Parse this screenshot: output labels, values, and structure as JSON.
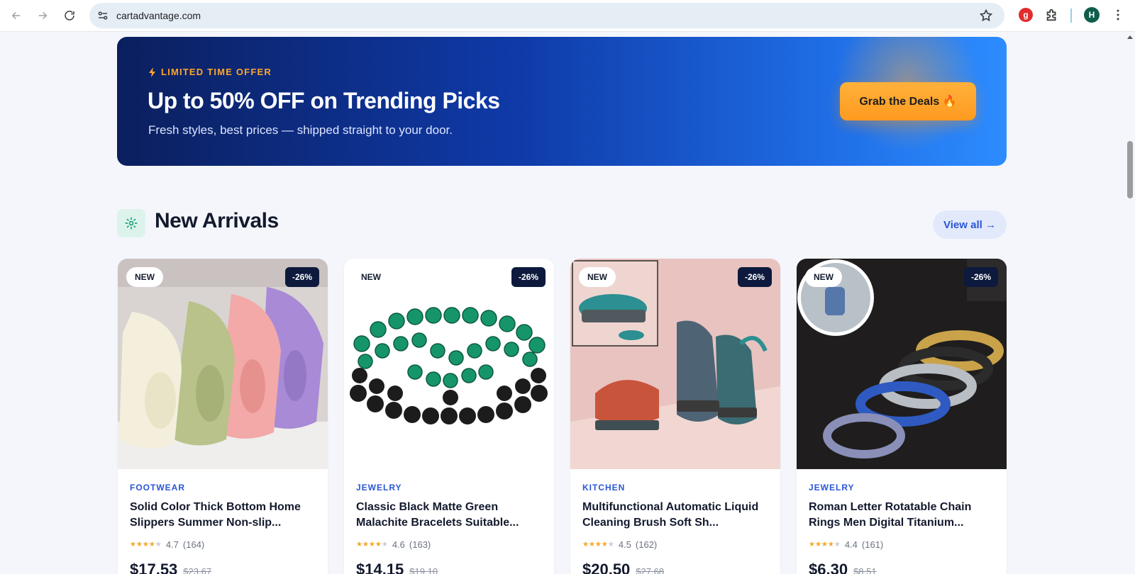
{
  "browser": {
    "url": "cartadvantage.com",
    "grammarly_label": "g",
    "profile_initial": "H"
  },
  "promo": {
    "tag": "LIMITED TIME OFFER",
    "title": "Up to 50% OFF on Trending Picks",
    "subtitle": "Fresh styles, best prices — shipped straight to your door.",
    "cta_label": "Grab the Deals 🔥"
  },
  "section": {
    "title": "New Arrivals",
    "view_all_label": "View all →"
  },
  "products": [
    {
      "badge_new": "NEW",
      "discount": "-26%",
      "category": "FOOTWEAR",
      "title": "Solid Color Thick Bottom Home Slippers Summer Non-slip...",
      "rating": 4.7,
      "rating_text": "4.7",
      "reviews": "(164)",
      "price": "$17.53",
      "old_price": "$23.67"
    },
    {
      "badge_new": "NEW",
      "discount": "-26%",
      "category": "JEWELRY",
      "title": "Classic Black Matte Green Malachite Bracelets Suitable...",
      "rating": 4.6,
      "rating_text": "4.6",
      "reviews": "(163)",
      "price": "$14.15",
      "old_price": "$19.10"
    },
    {
      "badge_new": "NEW",
      "discount": "-26%",
      "category": "KITCHEN",
      "title": "Multifunctional Automatic Liquid Cleaning Brush Soft Sh...",
      "rating": 4.5,
      "rating_text": "4.5",
      "reviews": "(162)",
      "price": "$20.50",
      "old_price": "$27.68"
    },
    {
      "badge_new": "NEW",
      "discount": "-26%",
      "category": "JEWELRY",
      "title": "Roman Letter Rotatable Chain Rings Men Digital Titanium...",
      "rating": 4.4,
      "rating_text": "4.4",
      "reviews": "(161)",
      "price": "$6.30",
      "old_price": "$8.51"
    }
  ],
  "colors": {
    "accent": "#2a55d6",
    "cta": "#ffa62b",
    "banner_dark": "#0b1f5e",
    "banner_light": "#2d8cff"
  }
}
